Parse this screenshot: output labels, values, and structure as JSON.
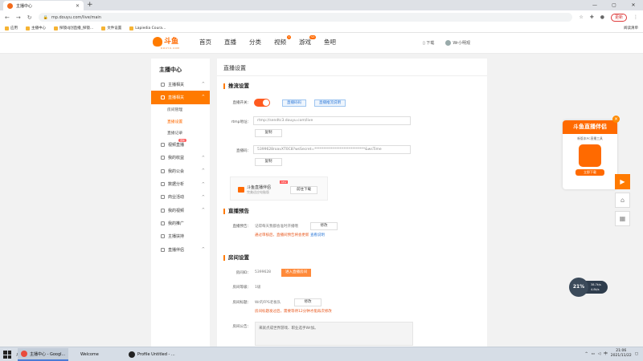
{
  "browser": {
    "tab_title": "主播中心",
    "url": "mp.douyu.com/live/main",
    "profile_button": "更新",
    "bookmarks": [
      "应用",
      "主播中心",
      "探镜dJ创直播_探镜...",
      "文件设置",
      "Lapiedia Coura..."
    ],
    "other_bookmarks": "阅读清单"
  },
  "site": {
    "logo_text": "斗鱼",
    "logo_sub": "DOUYU.COM",
    "nav": [
      {
        "label": "首页",
        "badge": ""
      },
      {
        "label": "直播",
        "badge": ""
      },
      {
        "label": "分类",
        "badge": ""
      },
      {
        "label": "视频",
        "badge": "4"
      },
      {
        "label": "游戏",
        "badge": "hot"
      },
      {
        "label": "鱼吧",
        "badge": ""
      }
    ],
    "download": "下载",
    "username": "Wr小明观"
  },
  "sidebar": {
    "title": "主播中心",
    "items": [
      {
        "label": "主播相关",
        "type": "item",
        "active": false,
        "chev": "^"
      },
      {
        "label": "直播相关",
        "type": "item",
        "active": true,
        "chev": "^"
      },
      {
        "label": "房间管理",
        "type": "sub",
        "current": false
      },
      {
        "label": "直播设置",
        "type": "sub",
        "current": true
      },
      {
        "label": "直播记录",
        "type": "sub",
        "current": false
      },
      {
        "label": "视频直播",
        "type": "item",
        "active": false,
        "chev": "",
        "tag": "更新"
      },
      {
        "label": "我的收益",
        "type": "item",
        "active": false,
        "chev": "^"
      },
      {
        "label": "我的公会",
        "type": "item",
        "active": false,
        "chev": "^"
      },
      {
        "label": "数据分析",
        "type": "item",
        "active": false,
        "chev": "^"
      },
      {
        "label": "商业活动",
        "type": "item",
        "active": false,
        "chev": "^"
      },
      {
        "label": "我的视频",
        "type": "item",
        "active": false,
        "chev": "^"
      },
      {
        "label": "我的推广",
        "type": "item",
        "active": false,
        "chev": ""
      },
      {
        "label": "主播扶持",
        "type": "item",
        "active": false,
        "chev": ""
      },
      {
        "label": "直播伴侣",
        "type": "item",
        "active": false,
        "chev": "^"
      }
    ]
  },
  "main": {
    "title": "直播设置",
    "stream": {
      "heading": "推流设置",
      "switch_label": "直播开关：",
      "switch_on": true,
      "btn_stream_code": "直播码码",
      "btn_third_party": "直播推流说明",
      "rtmp_label": "rtmp地址：",
      "rtmp_value": "rtmp://sendtc3.douyu.com/live",
      "copy1": "复制",
      "code_label": "直播码：",
      "code_value": "5399628roavXT0C8?wsSecret=****************************&wsTime",
      "copy2": "复制",
      "promo_name": "斗鱼直播伴侣",
      "promo_new": "NEW",
      "promo_desc": "完美适应电脑版",
      "promo_download": "前往下载"
    },
    "notice": {
      "heading": "直播预告",
      "label": "直播预告：",
      "value": "记得每天我都会准时开播哦",
      "edit": "修改",
      "warn": "通过审核后，直播间预告将会更新",
      "warn_link": "查看说明"
    },
    "room": {
      "heading": "房间设置",
      "id_label": "房间ID：",
      "id_value": "5399628",
      "enter_btn": "进入直播房间",
      "level_label": "房间等级：",
      "level_value": "1级",
      "name_label": "房间标题：",
      "name_value": "Wr的FPS老板队",
      "edit": "修改",
      "name_warn": "房间标题发过后，需要等待12分钟才能再次修改",
      "notice_label": "房间公告：",
      "notice_value": "来就点成世界游戏、职业选手Wr加。"
    }
  },
  "ad": {
    "title": "斗鱼直播伴侣",
    "desc": "新版本PC直播工具",
    "button": "立即下载"
  },
  "network": {
    "percent": "21%",
    "up": "38.7k/s",
    "down": "4.8k/s"
  },
  "taskbar": {
    "apps": [
      "主播中心 - Googl...",
      "Welcome",
      "Profile Untitled - ..."
    ],
    "lang": "中",
    "time": "21:06",
    "date": "2021/11/22"
  }
}
